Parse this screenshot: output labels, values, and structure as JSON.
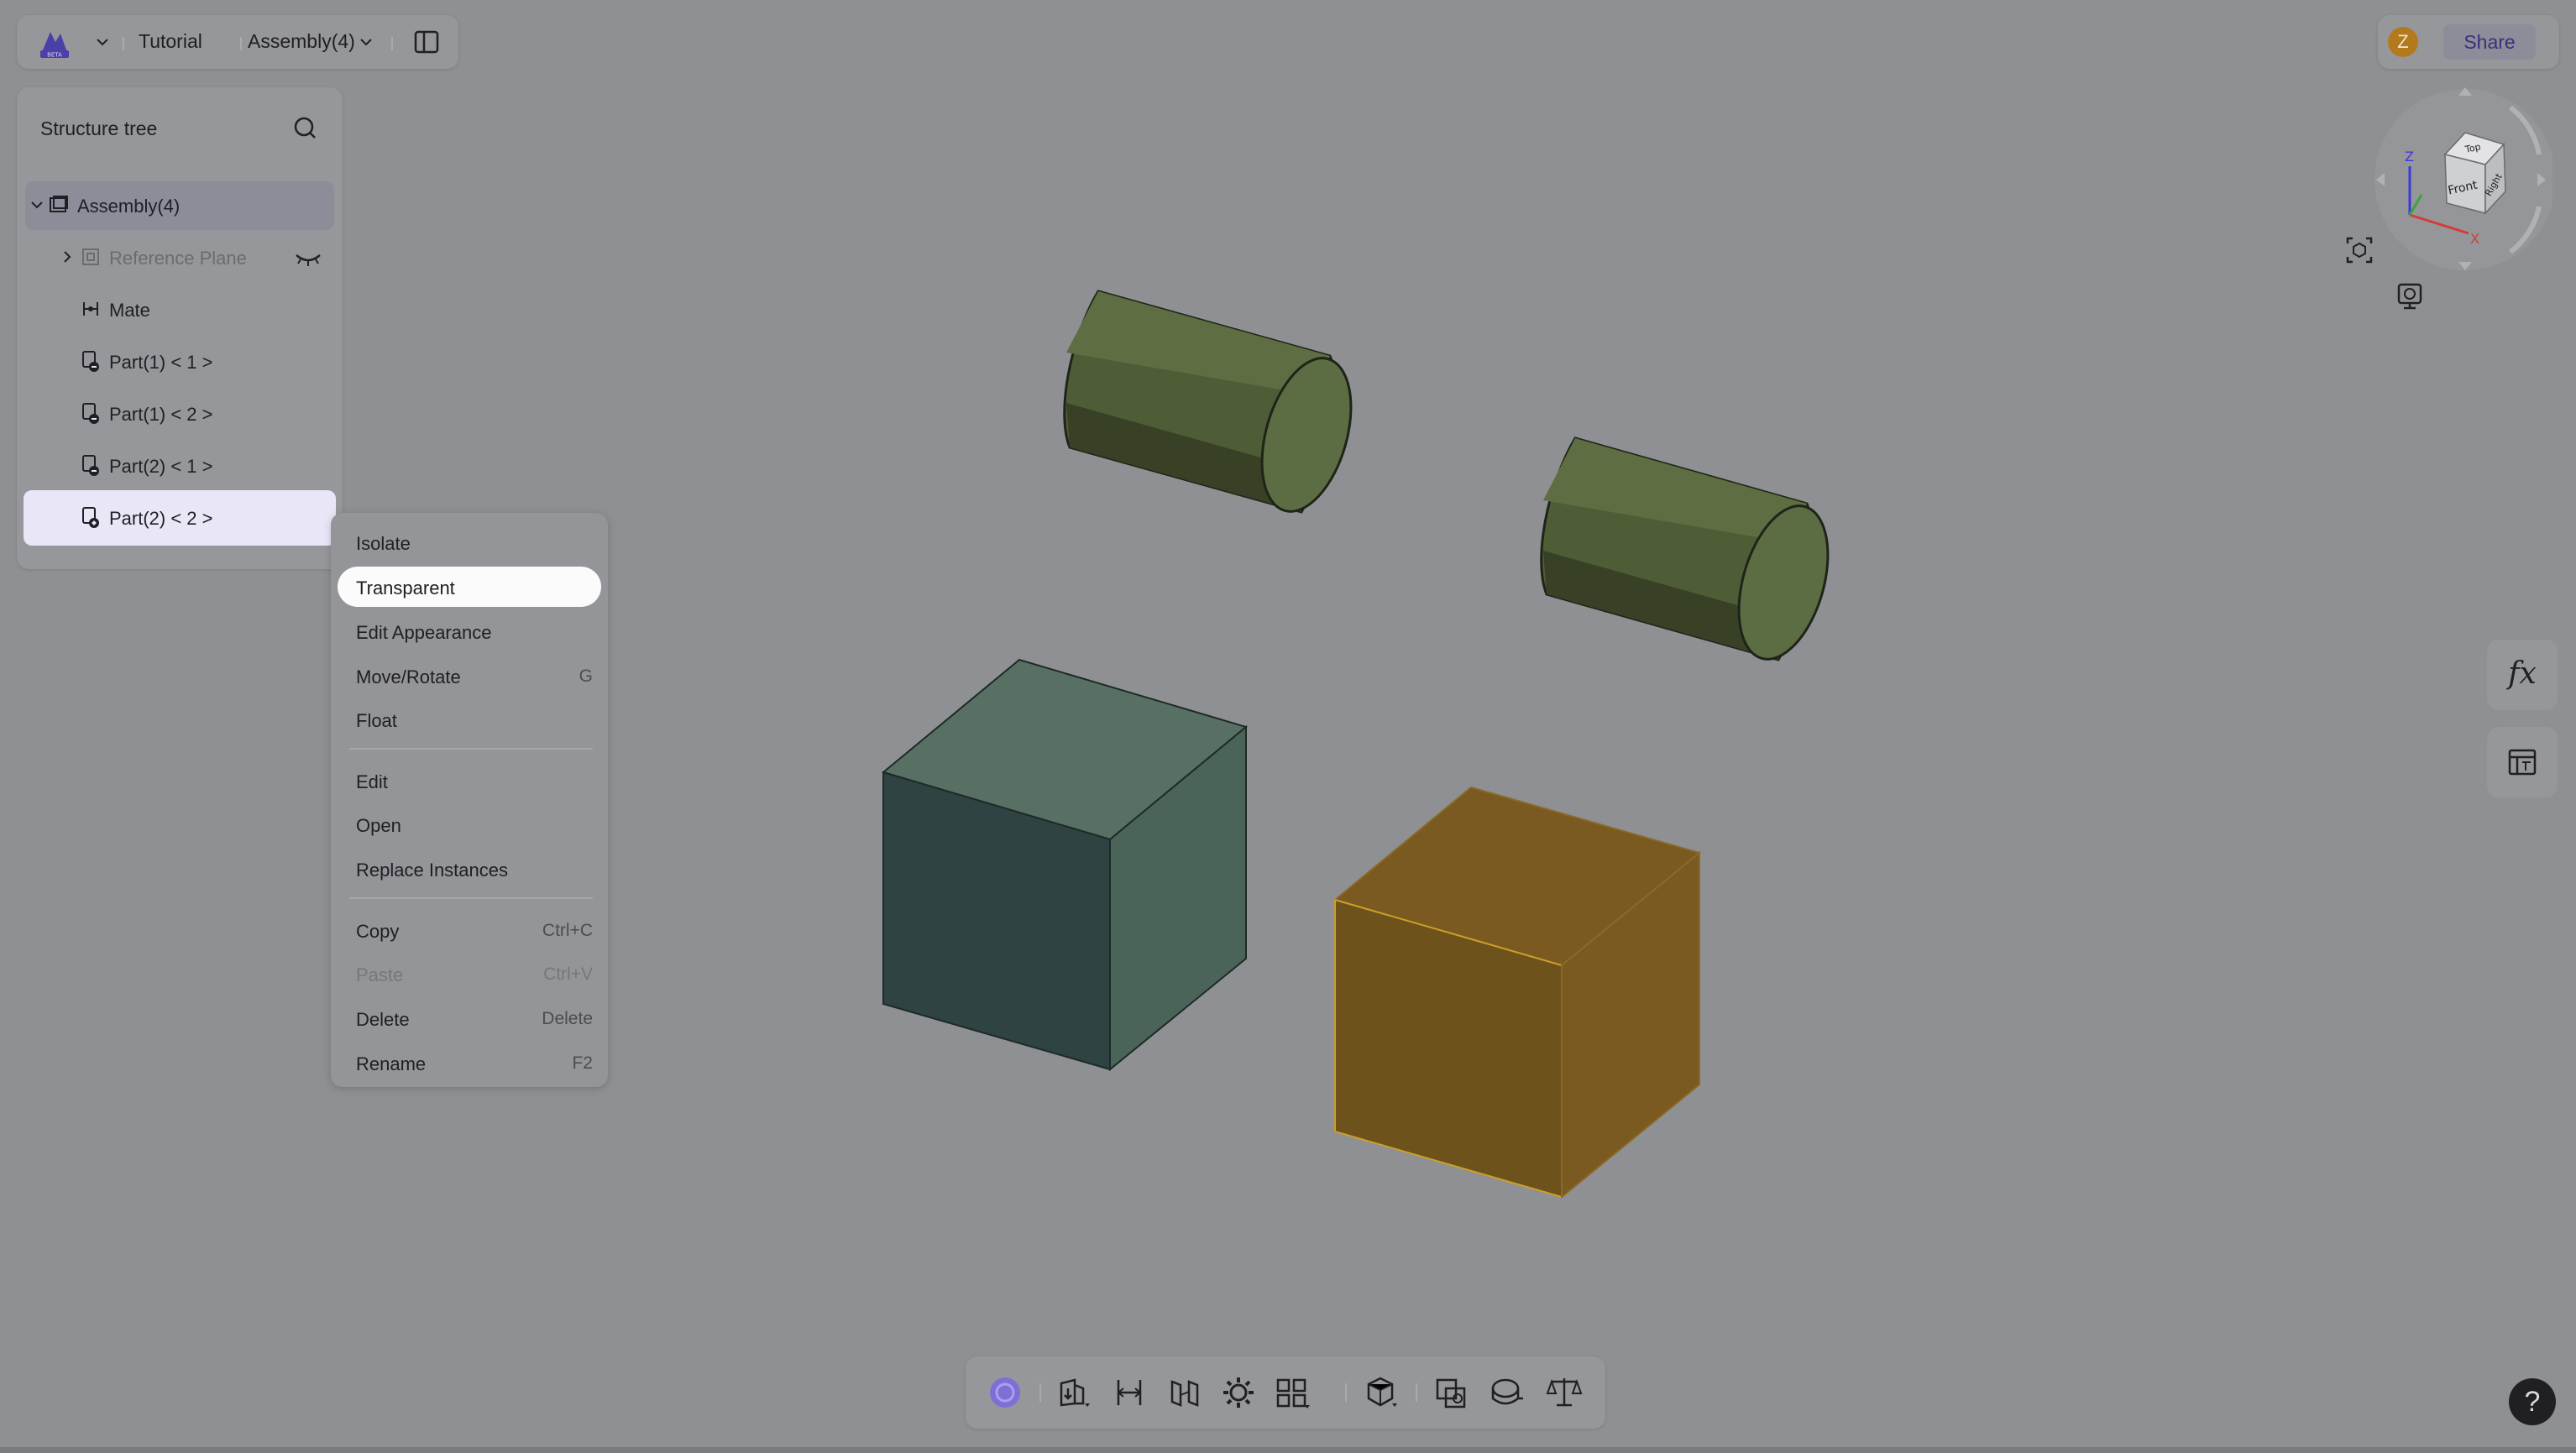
{
  "header": {
    "logo_badge": "BETA",
    "project": "Tutorial",
    "document": "Assembly(4)"
  },
  "topright": {
    "avatar_initial": "Z",
    "share_label": "Share"
  },
  "tree": {
    "title": "Structure tree",
    "items": [
      {
        "label": "Assembly(4)"
      },
      {
        "label": "Reference Plane"
      },
      {
        "label": "Mate"
      },
      {
        "label": "Part(1) < 1 >"
      },
      {
        "label": "Part(1) < 2 >"
      },
      {
        "label": "Part(2) < 1 >"
      },
      {
        "label": "Part(2) < 2 >"
      }
    ]
  },
  "context_menu": {
    "items": [
      {
        "label": "Isolate",
        "shortcut": ""
      },
      {
        "label": "Transparent",
        "shortcut": ""
      },
      {
        "label": "Edit Appearance",
        "shortcut": ""
      },
      {
        "label": "Move/Rotate",
        "shortcut": "G"
      },
      {
        "label": "Float",
        "shortcut": ""
      },
      {
        "label": "Edit",
        "shortcut": ""
      },
      {
        "label": "Open",
        "shortcut": ""
      },
      {
        "label": "Replace Instances",
        "shortcut": ""
      },
      {
        "label": "Copy",
        "shortcut": "Ctrl+C"
      },
      {
        "label": "Paste",
        "shortcut": "Ctrl+V"
      },
      {
        "label": "Delete",
        "shortcut": "Delete"
      },
      {
        "label": "Rename",
        "shortcut": "F2"
      }
    ]
  },
  "viewcube": {
    "faces": [
      "Top",
      "Front",
      "Right"
    ],
    "axes": [
      "Z",
      "X"
    ]
  },
  "side": {
    "fx_label": "fx",
    "help_label": "?"
  },
  "colors": {
    "cylinder": "#5e6e42",
    "cube_teal": "#4a6459",
    "cube_orange": "#7a5a20",
    "accent": "#6a5acd",
    "selected_row": "#e9e6f8"
  }
}
